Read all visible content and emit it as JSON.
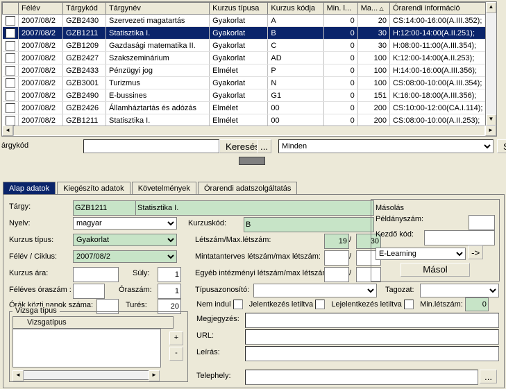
{
  "table": {
    "headers": [
      "",
      "Félév",
      "Tárgykód",
      "Tárgynév",
      "Kurzus típusa",
      "Kurzus kódja",
      "Min. l...",
      "Ma...",
      "Órarendi információ"
    ],
    "sort_col_glyph": "△",
    "rows": [
      {
        "felev": "2007/08/2",
        "kod": "GZB2430",
        "nev": "Szervezeti magatartás",
        "tip": "Gyakorlat",
        "kkod": "A",
        "min": "0",
        "max": "20",
        "ora": "CS:14:00-16:00(A.III.352);"
      },
      {
        "felev": "2007/08/2",
        "kod": "GZB1211",
        "nev": "Statisztika I.",
        "tip": "Gyakorlat",
        "kkod": "B",
        "min": "0",
        "max": "30",
        "ora": "H:12:00-14:00(A.II.251);",
        "sel": true
      },
      {
        "felev": "2007/08/2",
        "kod": "GZB1209",
        "nev": "Gazdasági matematika II.",
        "tip": "Gyakorlat",
        "kkod": "C",
        "min": "0",
        "max": "30",
        "ora": "H:08:00-11:00(A.III.354);"
      },
      {
        "felev": "2007/08/2",
        "kod": "GZB2427",
        "nev": "Szakszeminárium",
        "tip": "Gyakorlat",
        "kkod": "AD",
        "min": "0",
        "max": "100",
        "ora": "K:12:00-14:00(A.II.253);"
      },
      {
        "felev": "2007/08/2",
        "kod": "GZB2433",
        "nev": "Pénzügyi jog",
        "tip": "Elmélet",
        "kkod": "P",
        "min": "0",
        "max": "100",
        "ora": "H:14:00-16:00(A.III.356);"
      },
      {
        "felev": "2007/08/2",
        "kod": "GZB3001",
        "nev": "Turizmus",
        "tip": "Gyakorlat",
        "kkod": "N",
        "min": "0",
        "max": "100",
        "ora": "CS:08:00-10:00(A.III.354);"
      },
      {
        "felev": "2007/08/2",
        "kod": "GZB2490",
        "nev": "E-bussines",
        "tip": "Gyakorlat",
        "kkod": "G1",
        "min": "0",
        "max": "151",
        "ora": "K:16:00-18:00(A.III.356);"
      },
      {
        "felev": "2007/08/2",
        "kod": "GZB2426",
        "nev": "Államháztartás és adózás",
        "tip": "Elmélet",
        "kkod": "00",
        "min": "0",
        "max": "200",
        "ora": "CS:10:00-12:00(CA.I.114);"
      },
      {
        "felev": "2007/08/2",
        "kod": "GZB1211",
        "nev": "Statisztika I.",
        "tip": "Elmélet",
        "kkod": "00",
        "min": "0",
        "max": "200",
        "ora": "CS:08:00-10:00(A.II.253);"
      }
    ]
  },
  "search": {
    "label": "árgykód",
    "value": "",
    "keres": "Keresés",
    "dots": "...",
    "filter": "Minden",
    "szures": "Szűré"
  },
  "tabs": {
    "t1": "Alap adatok",
    "t2": "Kiegészíto adatok",
    "t3": "Követelmények",
    "t4": "Órarendi adatszolgáltatás"
  },
  "form": {
    "targy_l": "Tárgy:",
    "targy_kod": "GZB1211",
    "targy_nev": "Statisztika I.",
    "nyelv_l": "Nyelv:",
    "nyelv_v": "magyar",
    "kurzuskod_l": "Kurzuskód:",
    "kurzuskod_v": "B",
    "ktip_l": "Kurzus típus:",
    "ktip_v": "Gyakorlat",
    "letszam_l": "Létszám/Max.létszám:",
    "letszam_a": "19",
    "letszam_sep": "/",
    "letszam_b": "30",
    "felev_l": "Félév / Ciklus:",
    "felev_v": "2007/08/2",
    "minta_l": "Mintatanterves létszám/max létszám:",
    "minta_sep": "/",
    "kara_l": "Kurzus ára:",
    "suly_l": "Súly:",
    "suly_v": "1",
    "egyeb_l": "Egyéb intézményi létszám/max létszám:",
    "egyeb_sep": "/",
    "feleves_l": "Féléves óraszám :",
    "orasz_l": "Óraszám:",
    "orasz_v": "1",
    "tipaz_l": "Típusazonosító:",
    "tagozat_l": "Tagozat:",
    "orak_l": "Órák közti napok száma:",
    "tures_l": "Turés:",
    "tures_v": "20",
    "nemindul_l": "Nem indul",
    "jel_l": "Jelentkezés letiltva",
    "lejel_l": "Lejelentkezés letiltva",
    "minl_l": "Min.létszám:",
    "minl_v": "0",
    "megj_l": "Megjegyzés:",
    "url_l": "URL:",
    "leir_l": "Leírás:",
    "tel_l": "Telephely:"
  },
  "right": {
    "masolas": "Másolás",
    "peld": "Példányszám:",
    "kezdo": "Kezdő kód:",
    "elearn": "E-Learning",
    "arrow": "->",
    "masol": "Másol"
  },
  "vizsga": {
    "box": "Vizsga típus",
    "col": "Vizsgatípus",
    "plus": "+",
    "minus": "-"
  },
  "dots": "..."
}
